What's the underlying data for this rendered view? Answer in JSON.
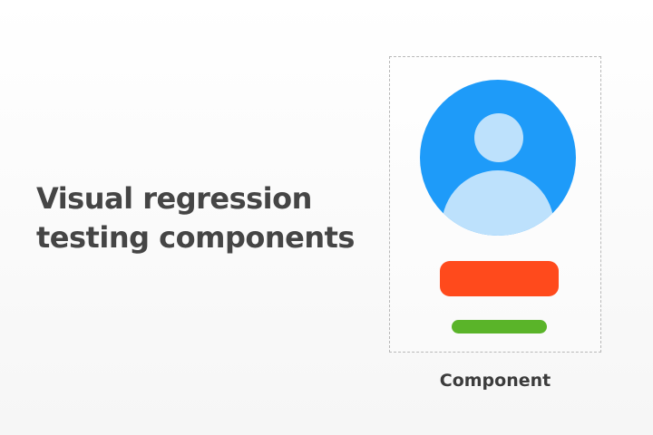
{
  "headline": {
    "line1": "Visual regression",
    "line2": "testing components"
  },
  "component": {
    "label": "Component",
    "avatar_icon": "user-avatar-icon",
    "colors": {
      "avatar_background": "#1e9bf9",
      "avatar_figure": "#bde1fc",
      "primary_button": "#ff4a1c",
      "secondary_bar": "#5ab429"
    }
  }
}
